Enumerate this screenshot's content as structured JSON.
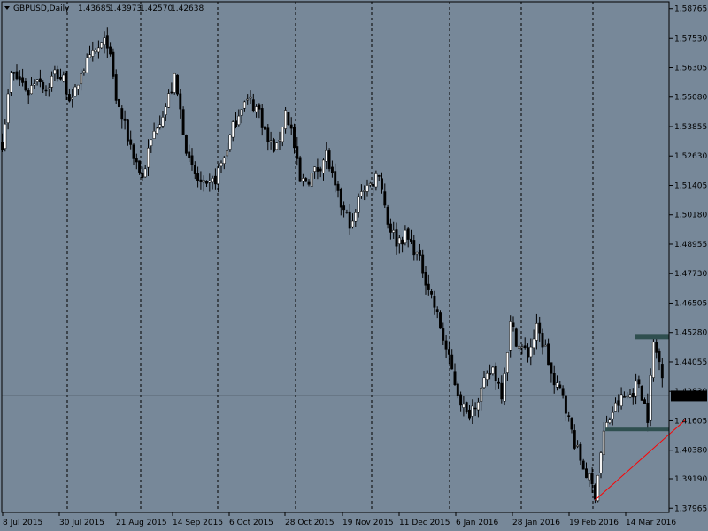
{
  "colors": {
    "background": "#778899",
    "candle": "#000000",
    "bull_body": "#FFFFFF",
    "bear_body": "#000000",
    "grid": "#000000",
    "zone": "#2F4F4F",
    "trendline": "#FF0000",
    "price_label_bg": "#000000",
    "price_label_text": "#FFFFFF"
  },
  "header": {
    "symbol": "GBPUSD,Daily",
    "open": "1.43685",
    "high": "1.43973",
    "low": "1.42570",
    "close": "1.42638"
  },
  "chart_data": {
    "type": "candlestick",
    "y_axis_ticks": [
      "1.58765",
      "1.57530",
      "1.56305",
      "1.55080",
      "1.53855",
      "1.52630",
      "1.51405",
      "1.50180",
      "1.48955",
      "1.47730",
      "1.46505",
      "1.45280",
      "1.44055",
      "1.42830",
      "1.41605",
      "1.40380",
      "1.39190",
      "1.37965"
    ],
    "x_axis_labels": [
      "8 Jul 2015",
      "30 Jul 2015",
      "21 Aug 2015",
      "14 Sep 2015",
      "6 Oct 2015",
      "28 Oct 2015",
      "19 Nov 2015",
      "11 Dec 2015",
      "6 Jan 2016",
      "28 Jan 2016",
      "19 Feb 2016",
      "14 Mar 2016"
    ],
    "ylim": [
      1.3779,
      1.5905
    ],
    "current_price": "1.42638",
    "close_path": [
      [
        0,
        1.532
      ],
      [
        3,
        1.56
      ],
      [
        6,
        1.558
      ],
      [
        9,
        1.553
      ],
      [
        12,
        1.56
      ],
      [
        15,
        1.554
      ],
      [
        18,
        1.561
      ],
      [
        21,
        1.558
      ],
      [
        24,
        1.548
      ],
      [
        27,
        1.562
      ],
      [
        30,
        1.566
      ],
      [
        33,
        1.571
      ],
      [
        36,
        1.574
      ],
      [
        39,
        1.55
      ],
      [
        42,
        1.538
      ],
      [
        45,
        1.527
      ],
      [
        48,
        1.517
      ],
      [
        50,
        1.528
      ],
      [
        53,
        1.54
      ],
      [
        56,
        1.547
      ],
      [
        59,
        1.558
      ],
      [
        61,
        1.545
      ],
      [
        64,
        1.523
      ],
      [
        67,
        1.516
      ],
      [
        70,
        1.512
      ],
      [
        73,
        1.517
      ],
      [
        76,
        1.526
      ],
      [
        79,
        1.538
      ],
      [
        82,
        1.548
      ],
      [
        85,
        1.549
      ],
      [
        88,
        1.545
      ],
      [
        91,
        1.532
      ],
      [
        94,
        1.529
      ],
      [
        97,
        1.545
      ],
      [
        99,
        1.537
      ],
      [
        102,
        1.515
      ],
      [
        105,
        1.517
      ],
      [
        108,
        1.521
      ],
      [
        111,
        1.527
      ],
      [
        114,
        1.512
      ],
      [
        117,
        1.503
      ],
      [
        120,
        1.497
      ],
      [
        123,
        1.513
      ],
      [
        126,
        1.514
      ],
      [
        129,
        1.52
      ],
      [
        132,
        1.499
      ],
      [
        135,
        1.491
      ],
      [
        138,
        1.493
      ],
      [
        141,
        1.488
      ],
      [
        144,
        1.479
      ],
      [
        147,
        1.468
      ],
      [
        150,
        1.455
      ],
      [
        153,
        1.441
      ],
      [
        156,
        1.428
      ],
      [
        159,
        1.418
      ],
      [
        162,
        1.424
      ],
      [
        165,
        1.431
      ],
      [
        168,
        1.438
      ],
      [
        171,
        1.428
      ],
      [
        174,
        1.456
      ],
      [
        177,
        1.447
      ],
      [
        180,
        1.444
      ],
      [
        183,
        1.454
      ],
      [
        186,
        1.446
      ],
      [
        189,
        1.43
      ],
      [
        192,
        1.428
      ],
      [
        194,
        1.416
      ],
      [
        197,
        1.403
      ],
      [
        200,
        1.394
      ],
      [
        203,
        1.386
      ],
      [
        206,
        1.411
      ],
      [
        209,
        1.42
      ],
      [
        212,
        1.425
      ],
      [
        215,
        1.427
      ],
      [
        218,
        1.432
      ],
      [
        221,
        1.418
      ],
      [
        223,
        1.448
      ],
      [
        226,
        1.43685
      ]
    ],
    "zones": [
      {
        "name": "resistance",
        "y1": 1.45,
        "y2": 1.4522
      },
      {
        "name": "support",
        "y1": 1.412,
        "y2": 1.4132
      }
    ],
    "trendline": {
      "from": [
        203,
        1.383
      ],
      "to": [
        234,
        1.4165
      ]
    }
  }
}
